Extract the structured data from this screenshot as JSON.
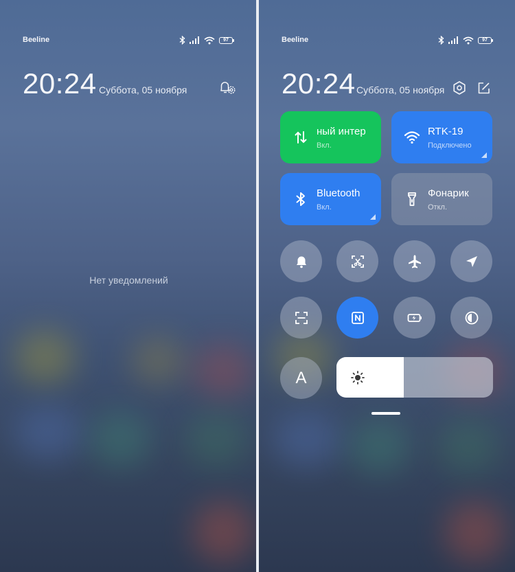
{
  "status_bar": {
    "carrier": "Beeline",
    "battery": "97"
  },
  "lock_screen": {
    "time": "20:24",
    "date": "Суббота, 05 ноября",
    "empty_text": "Нет уведомлений"
  },
  "control_center": {
    "time": "20:24",
    "date": "Суббота, 05 ноября",
    "tiles": {
      "mobile_data": {
        "label": "ный интер",
        "state": "Вкл."
      },
      "wifi": {
        "label": "RTK-19",
        "state": "Подключено"
      },
      "bluetooth": {
        "label": "Bluetooth",
        "state": "Вкл."
      },
      "flashlight": {
        "label": "Фонарик",
        "state": "Откл."
      }
    },
    "auto_brightness_letter": "A",
    "brightness_level": 0.43
  },
  "colors": {
    "active_green": "#15c45c",
    "active_blue": "#2f7ef0",
    "inactive": "rgba(175,185,202,0.45)"
  },
  "icons": [
    "bluetooth-icon",
    "signal-icon",
    "wifi-icon",
    "battery-icon",
    "notification-settings-icon",
    "settings-icon",
    "edit-icon",
    "mobile-data-icon",
    "flashlight-icon",
    "bell-icon",
    "screenshot-icon",
    "airplane-icon",
    "location-icon",
    "scanner-icon",
    "nfc-icon",
    "battery-saver-icon",
    "dark-mode-icon",
    "sun-icon"
  ]
}
